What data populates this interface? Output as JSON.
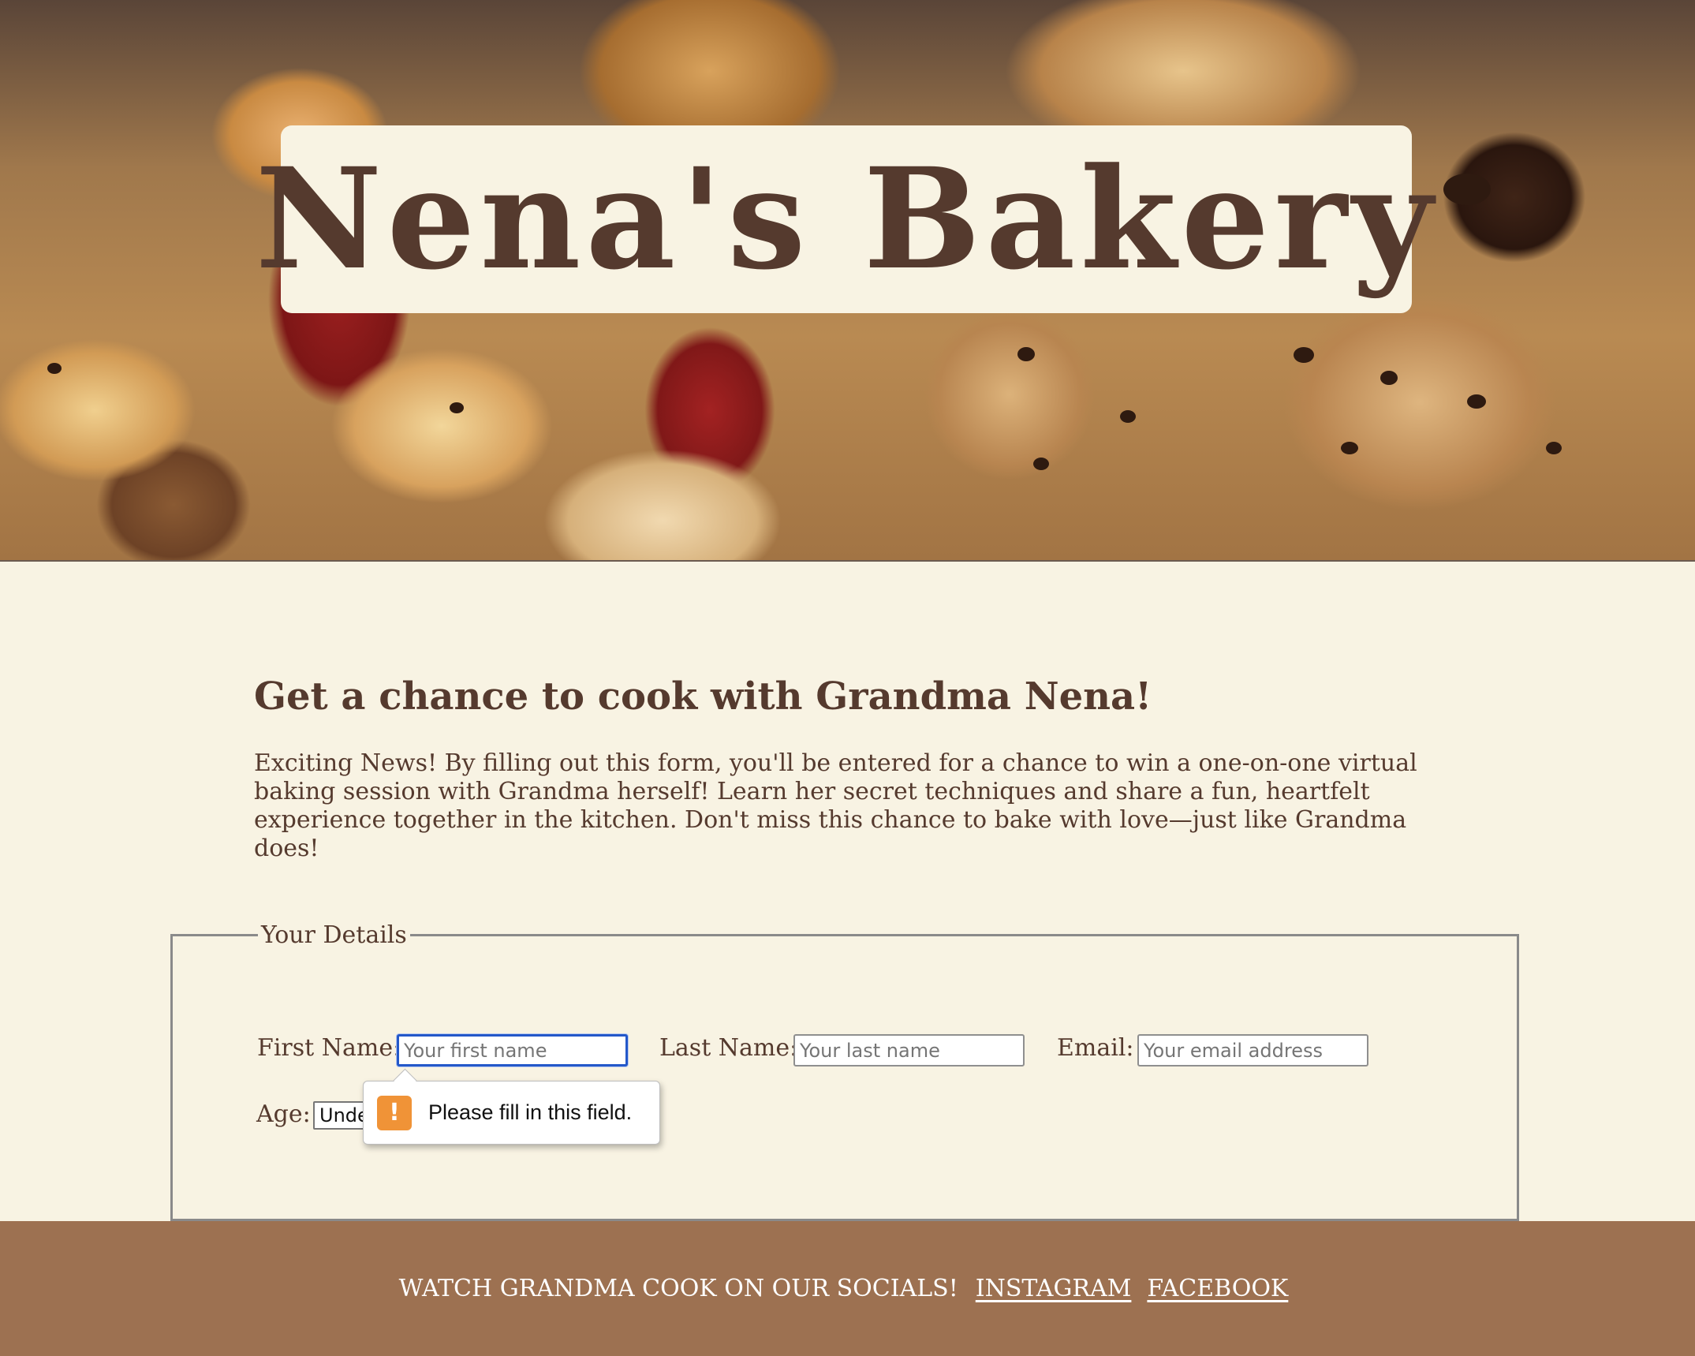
{
  "header": {
    "title": "Nena's Bakery"
  },
  "main": {
    "headline": "Get a chance to cook with Grandma Nena!",
    "intro": "Exciting News! By filling out this form, you'll be entered for a chance to win a one-on-one virtual baking session with Grandma herself! Learn her secret techniques and share a fun, heartfelt experience together in the kitchen. Don't miss this chance to bake with love—just like Grandma does!"
  },
  "form": {
    "legend": "Your Details",
    "first_name": {
      "label": "First Name:",
      "placeholder": "Your first name",
      "value": ""
    },
    "last_name": {
      "label": "Last Name:",
      "placeholder": "Your last name",
      "value": ""
    },
    "email": {
      "label": "Email:",
      "placeholder": "Your email address",
      "value": ""
    },
    "age": {
      "label": "Age:",
      "selected": "Unde"
    },
    "validation": {
      "icon": "warning-icon",
      "icon_glyph": "!",
      "message": "Please fill in this field."
    }
  },
  "footer": {
    "cta": "WATCH GRANDMA COOK ON OUR SOCIALS!",
    "links": [
      {
        "label": "INSTAGRAM"
      },
      {
        "label": "FACEBOOK"
      }
    ]
  },
  "colors": {
    "background": "#f8f3e3",
    "text_brown": "#553a2e",
    "footer_brown": "#9d7151",
    "focus_blue": "#2458c9",
    "warning_orange": "#f09337"
  }
}
